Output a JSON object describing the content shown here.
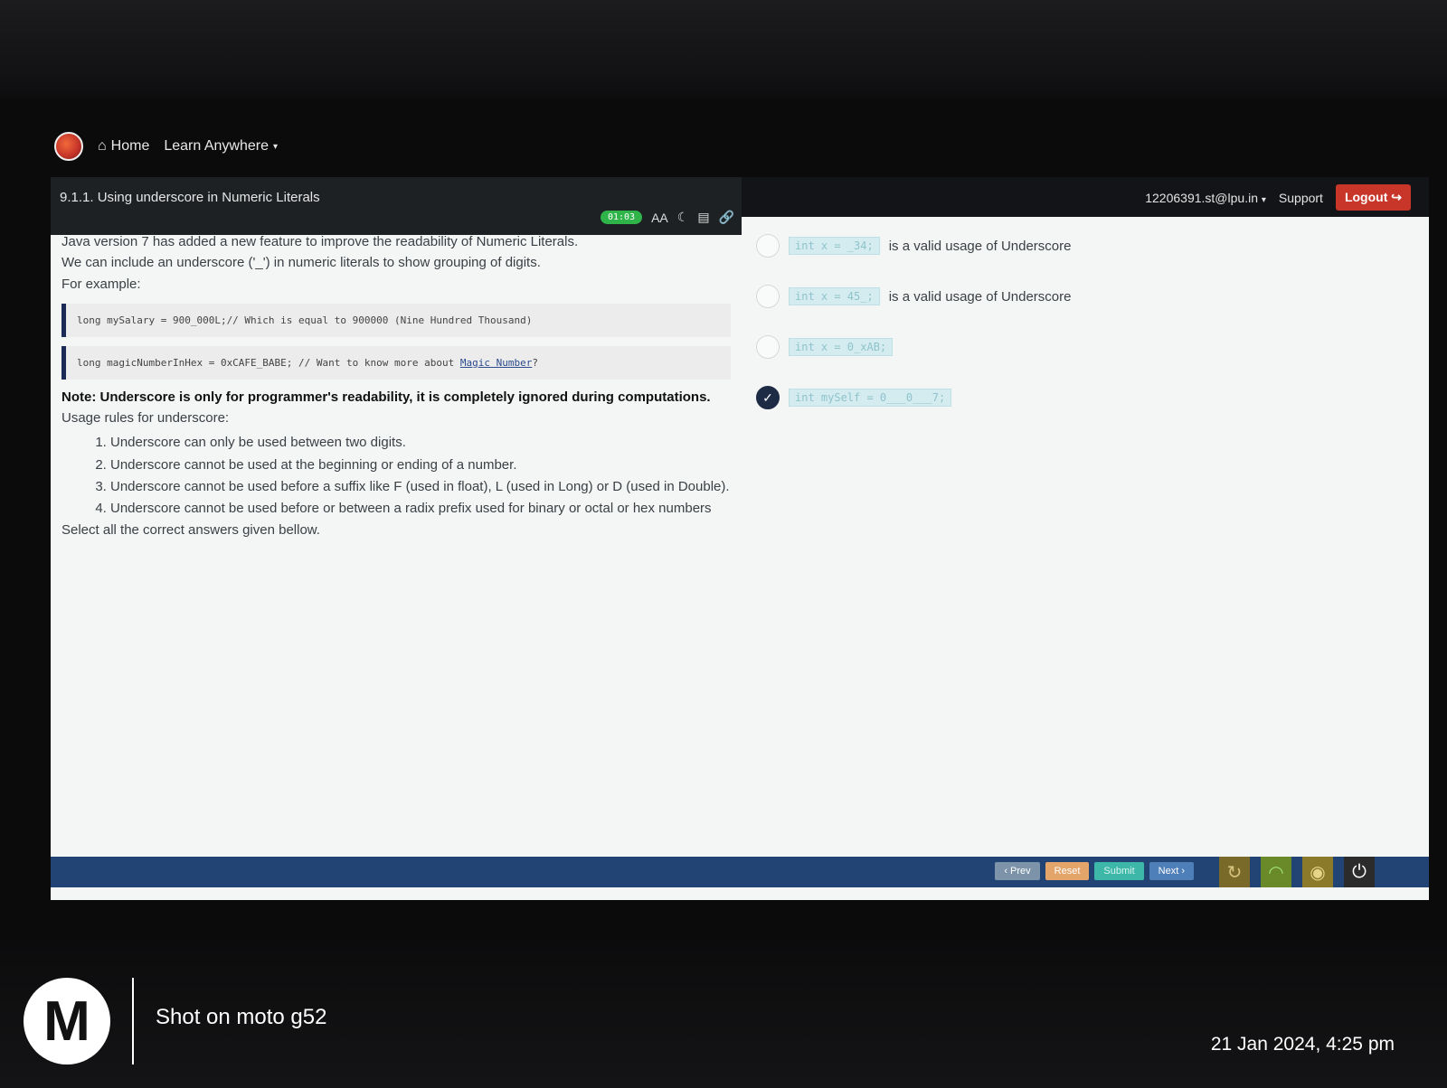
{
  "nav": {
    "home_label": "Home",
    "learn_label": "Learn Anywhere"
  },
  "header": {
    "lesson_title": "9.1.1. Using underscore in Numeric Literals",
    "timer": "01:03",
    "font_size_label": "AA"
  },
  "account": {
    "user": "12206391.st@lpu.in",
    "support_label": "Support",
    "logout_label": "Logout"
  },
  "content": {
    "intro_line1": "Java version 7 has added a new feature to improve the readability of Numeric Literals.",
    "intro_line2": "We can include an underscore ('_') in numeric literals to show grouping of digits.",
    "intro_line3": "For example:",
    "code1": "long mySalary = 900_000L;// Which is equal to 900000 (Nine Hundred Thousand)",
    "code2_prefix": "long magicNumberInHex = 0xCAFE_BABE; // Want to know more about ",
    "code2_link": "Magic Number",
    "code2_suffix": "?",
    "note": "Note: Underscore is only for programmer's readability, it is completely ignored during computations.",
    "rules_title": "Usage rules for underscore:",
    "rules": [
      "Underscore can only be used between two digits.",
      "Underscore cannot be used at the beginning or ending of a number.",
      "Underscore cannot be used before a suffix like F (used in float), L (used in Long) or D (used in Double).",
      "Underscore cannot be used before or between a radix prefix used for binary or octal or hex numbers"
    ],
    "instruction": "Select all the correct answers given bellow."
  },
  "options": [
    {
      "code": "int x = _34;",
      "text": "is a valid usage of Underscore",
      "checked": false
    },
    {
      "code": "int x = 45_;",
      "text": "is a valid usage of Underscore",
      "checked": false
    },
    {
      "code": "int x = 0_xAB;",
      "text": "",
      "checked": false
    },
    {
      "code": "int mySelf = 0___0___7;",
      "text": "",
      "checked": true
    }
  ],
  "buttons": {
    "prev": "‹ Prev",
    "reset": "Reset",
    "submit": "Submit",
    "next": "Next ›"
  },
  "icons": [
    "refresh-icon",
    "wifi-icon",
    "bulb-icon",
    "power-icon"
  ],
  "watermark": {
    "device": "Shot on moto g52",
    "datetime": "21 Jan 2024, 4:25 pm"
  }
}
